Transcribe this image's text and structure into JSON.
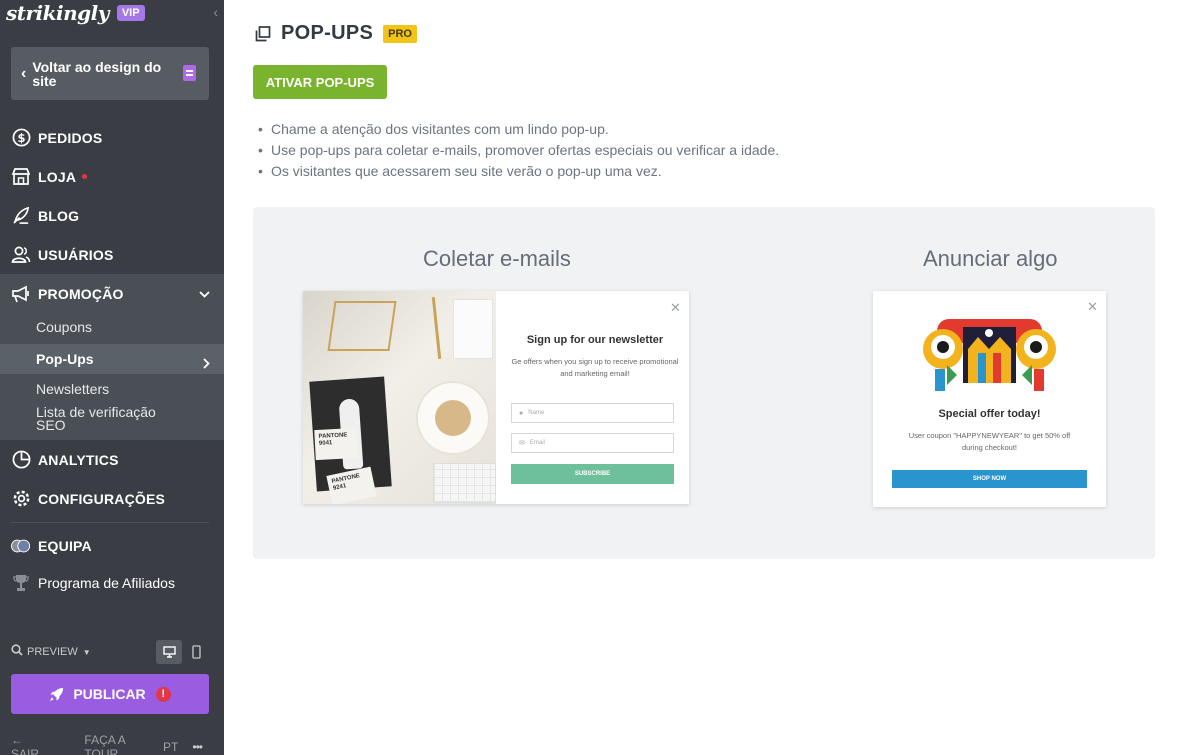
{
  "sidebar": {
    "logo": "strikingly",
    "vip_badge": "VIP",
    "back_button": "Voltar ao design do site",
    "nav": {
      "pedidos": "PEDIDOS",
      "loja": "LOJA",
      "blog": "BLOG",
      "usuarios": "USUÁRIOS",
      "promocao": "PROMOÇÃO",
      "analytics": "ANALYTICS",
      "configuracoes": "CONFIGURAÇÕES",
      "equipa": "EQUIPA"
    },
    "promocao_sub": {
      "coupons": "Coupons",
      "popups": "Pop-Ups",
      "newsletters": "Newsletters",
      "seo": "Lista de verificação SEO"
    },
    "affiliates": "Programa de Afiliados",
    "preview": "PREVIEW",
    "publish": "PUBLICAR",
    "publish_badge": "!",
    "bottom": {
      "exit": "SAIR",
      "tour": "FAÇA A TOUR",
      "lang": "PT",
      "more": "•••"
    }
  },
  "main": {
    "title": "POP-UPS",
    "pro_badge": "PRO",
    "activate_button": "ATIVAR POP-UPS",
    "bullets": [
      "Chame a atenção dos visitantes com um lindo pop-up.",
      "Use pop-ups para coletar e-mails, promover ofertas especiais ou verificar a idade.",
      "Os visitantes que acessarem seu site verão o pop-up uma vez."
    ],
    "templates": {
      "email": {
        "heading": "Coletar e-mails",
        "popup_title": "Sign up for our newsletter",
        "popup_text": "Ge offers when you sign up to receive promotional and marketing email!",
        "name_placeholder": "Name",
        "email_placeholder": "Email",
        "subscribe": "SUBSCRIBE",
        "pantone_a": "PANTONE 9041",
        "pantone_b": "PANTONE 9241"
      },
      "offer": {
        "heading": "Anunciar algo",
        "popup_title": "Special offer today!",
        "popup_text": "User coupon \"HAPPYNEWYEAR\" to get 50% off during checkout!",
        "shop_now": "SHOP NOW"
      }
    }
  },
  "colors": {
    "sidebar_bg": "#3a3e44",
    "activate_green": "#7ab32e",
    "publish_purple": "#9a5ce0",
    "pro_yellow": "#f0c419",
    "subscribe_green": "#6dc09a",
    "shop_blue": "#2a94cf"
  }
}
